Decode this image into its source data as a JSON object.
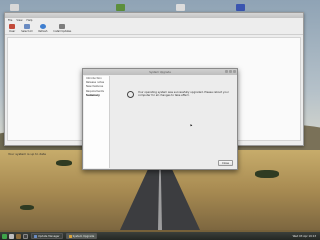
{
  "update_manager": {
    "menu": [
      "File",
      "View",
      "Help"
    ],
    "toolbar": [
      {
        "label": "Clear",
        "icon": "clear-icon"
      },
      {
        "label": "Select All",
        "icon": "select-all-icon"
      },
      {
        "label": "Refresh",
        "icon": "refresh-icon"
      },
      {
        "label": "Install Updates",
        "icon": "install-updates-icon"
      }
    ],
    "status": "Your system is up to date"
  },
  "dialog": {
    "title": "System Upgrade",
    "steps": [
      "Introduction",
      "Release notes",
      "New features",
      "Requirements",
      "Summary"
    ],
    "active_step": "Summary",
    "message": "Your operating system was successfully upgraded. Please reboot your computer for all changes to take effect.",
    "message_icon": "smiley-icon",
    "close_label": "Close"
  },
  "taskbar": {
    "tasks": [
      {
        "label": "Update Manager",
        "active": false
      },
      {
        "label": "System Upgrade",
        "active": true
      }
    ],
    "clock": "Wed 03 Apr 19:13"
  },
  "colors": {
    "taskbar": "#2b2f2b",
    "menu_icon": "#3fa34a",
    "refresh_icon": "#3f7fd0"
  }
}
